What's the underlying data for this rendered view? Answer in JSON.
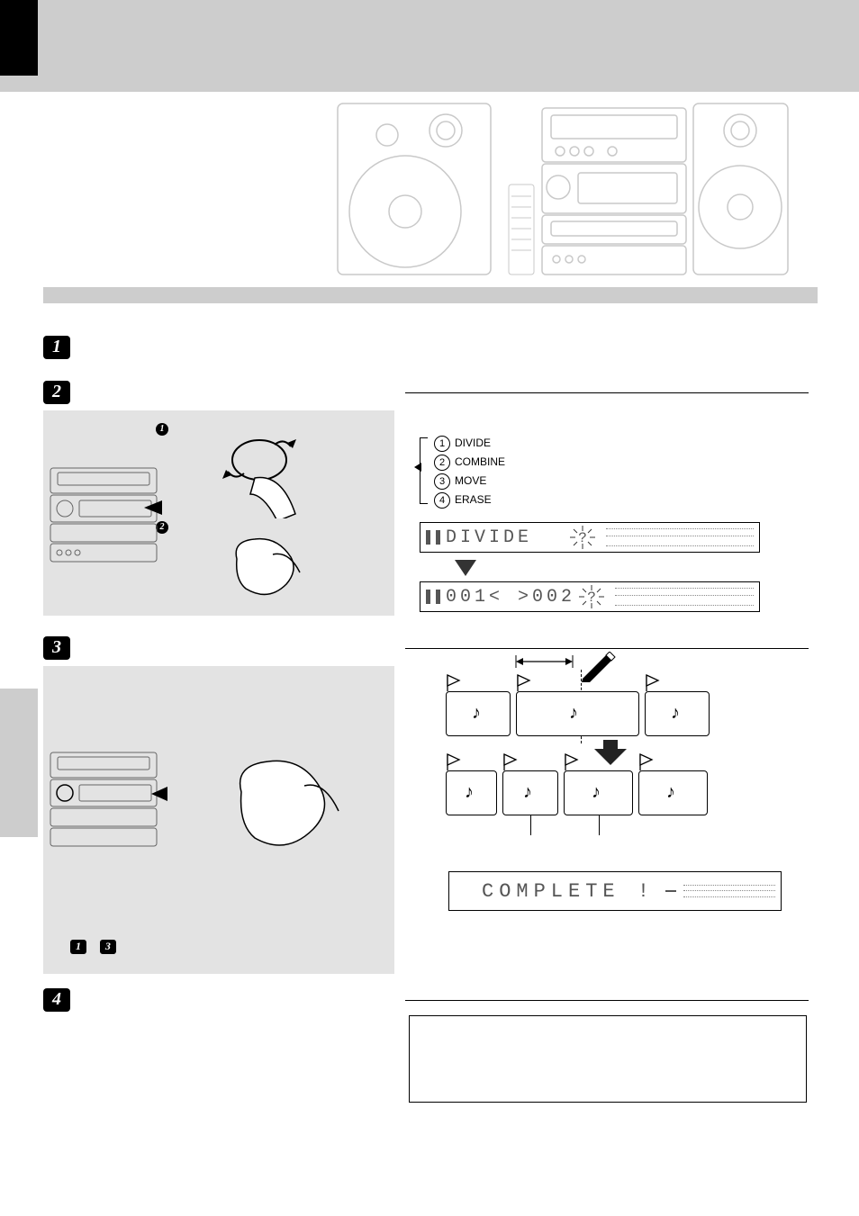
{
  "option_list": [
    "DIVIDE",
    "COMBINE",
    "MOVE",
    "ERASE"
  ],
  "displays": {
    "divide_label": "DIVIDE",
    "divide_mark": "?",
    "track_split": "001< >002",
    "complete": "COMPLETE !"
  },
  "diagram": {
    "arrow_label": "",
    "tracks_before": 3,
    "tracks_after": 4
  }
}
